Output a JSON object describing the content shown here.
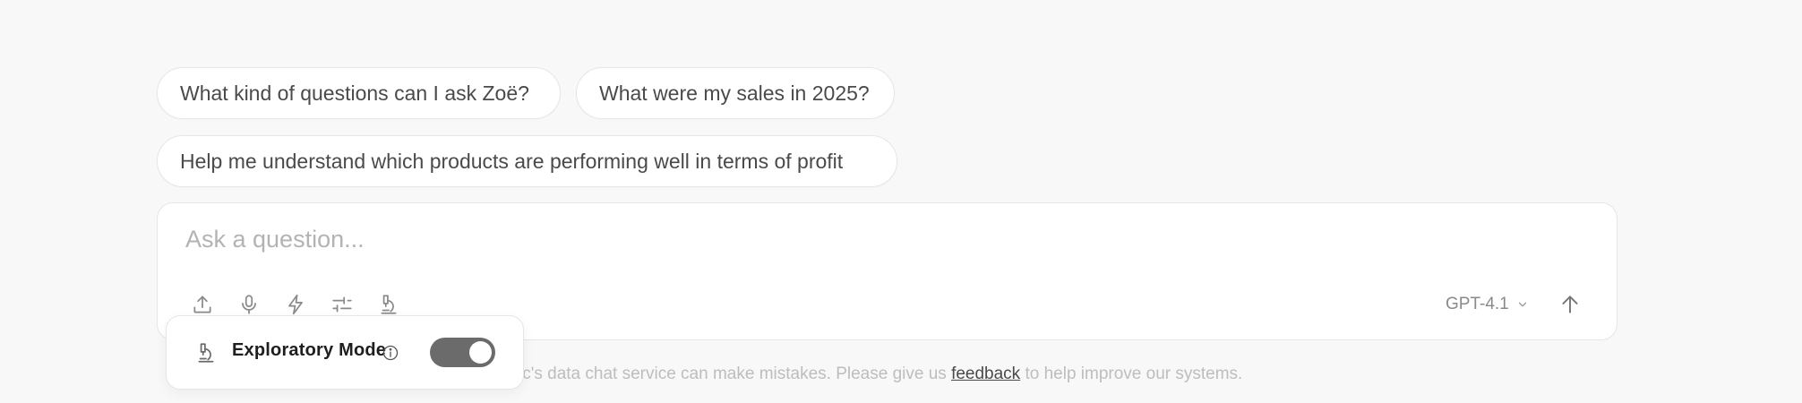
{
  "suggestions": [
    {
      "label": "What kind of questions can I ask Zoë?"
    },
    {
      "label": "What were my sales in 2025?"
    },
    {
      "label": "Help me understand which products are performing well in terms of profit"
    }
  ],
  "composer": {
    "placeholder": "Ask a question...",
    "value": "",
    "tools": [
      "upload-icon",
      "microphone-icon",
      "lightning-icon",
      "sliders-icon",
      "microscope-icon"
    ],
    "model": "GPT-4.1"
  },
  "exploratory": {
    "label": "Exploratory Mode",
    "enabled": true
  },
  "disclaimer": {
    "before": "lytic's data chat service can make mistakes. Please give us ",
    "link": "feedback",
    "after": " to help improve our systems."
  },
  "colors": {
    "background": "#f8f8f8",
    "toggle_on": "#6b6b6b",
    "placeholder": "#b3b3b3"
  }
}
